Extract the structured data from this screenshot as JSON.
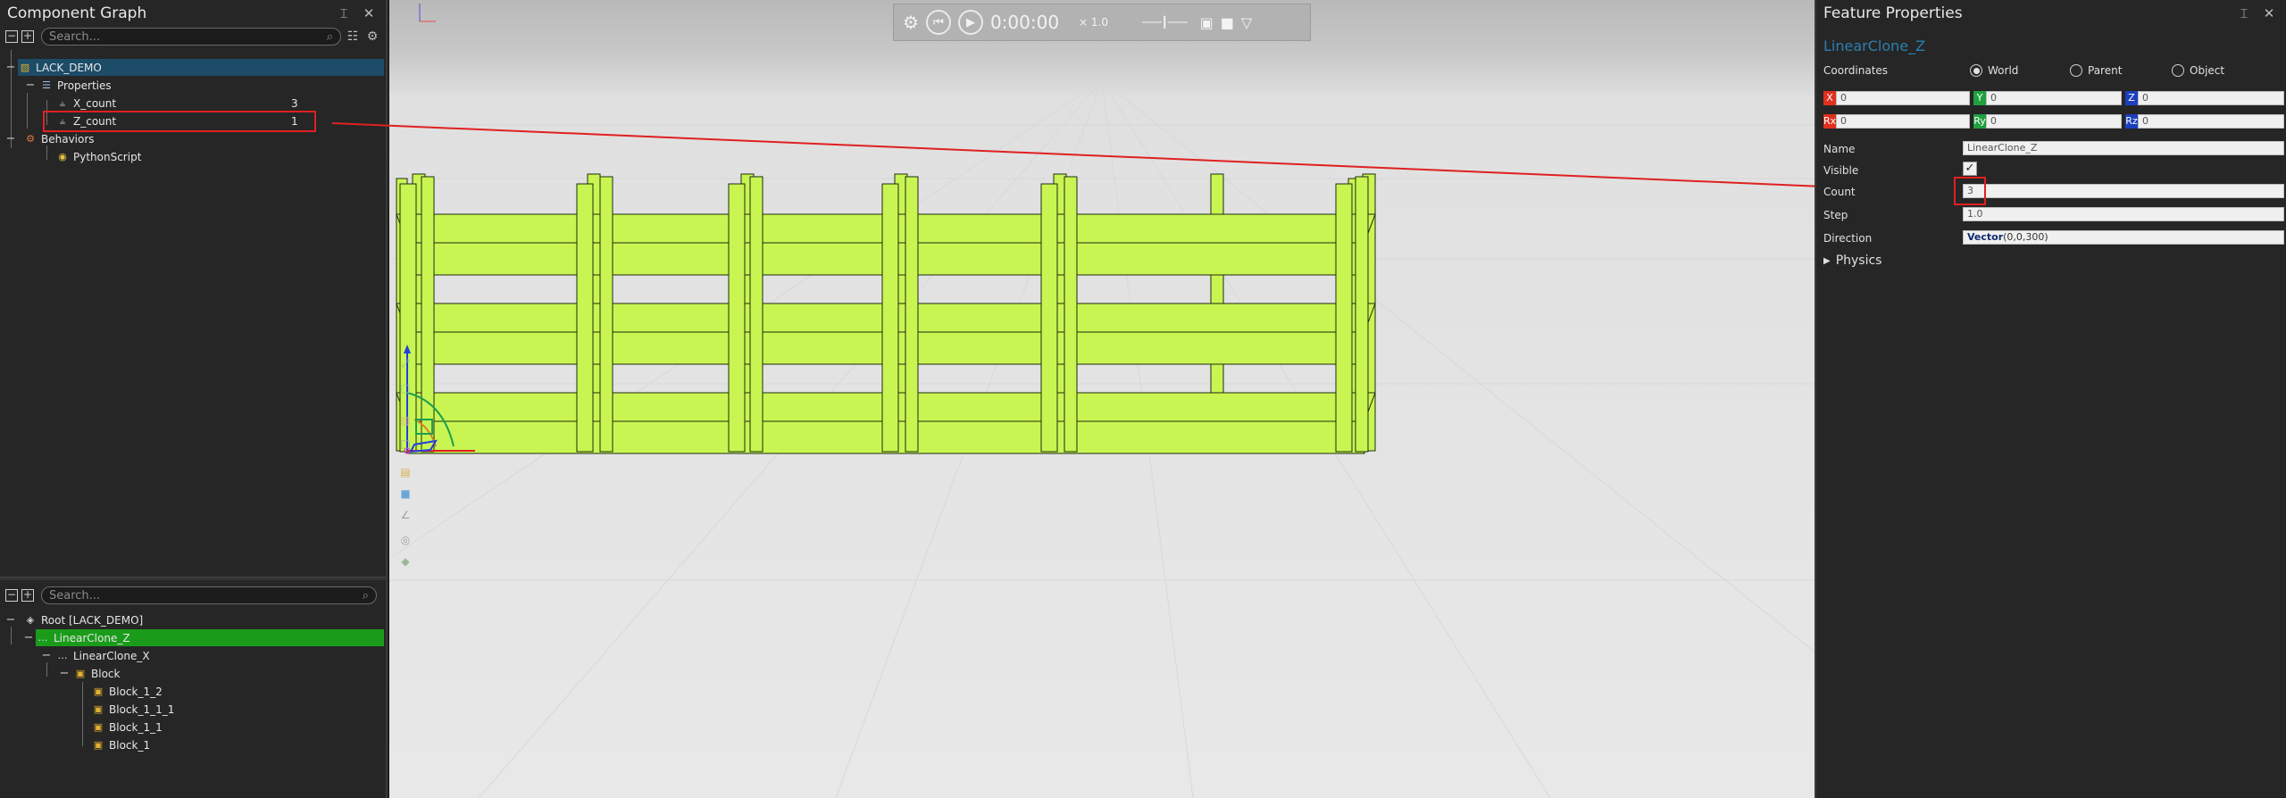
{
  "left_panel": {
    "title": "Component Graph",
    "pin_icon": "pin-icon",
    "close_icon": "close-icon",
    "search_placeholder": "Search...",
    "tree": {
      "root": "LACK_DEMO",
      "properties": "Properties",
      "x_count_label": "X_count",
      "x_count_value": "3",
      "z_count_label": "Z_count",
      "z_count_value": "1",
      "behaviors": "Behaviors",
      "python_script": "PythonScript"
    },
    "search_placeholder_2": "Search...",
    "tree2": {
      "root": "Root [LACK_DEMO]",
      "linear_clone_z": "LinearClone_Z",
      "linear_clone_x": "LinearClone_X",
      "block": "Block",
      "block_1_2": "Block_1_2",
      "block_1_1_1": "Block_1_1_1",
      "block_1_1": "Block_1_1",
      "block_1": "Block_1"
    }
  },
  "viewport": {
    "time": "0:00:00",
    "speed": "× 1.0"
  },
  "right_panel": {
    "title": "Feature Properties",
    "feature_name": "LinearClone_Z",
    "coordinates_label": "Coordinates",
    "radio_world": "World",
    "radio_parent": "Parent",
    "radio_object": "Object",
    "selected_coordinates": "World",
    "x_label": "X",
    "x_value": "0",
    "y_label": "Y",
    "y_value": "0",
    "z_label": "Z",
    "z_value": "0",
    "rx_label": "Rx",
    "rx_value": "0",
    "ry_label": "Ry",
    "ry_value": "0",
    "rz_label": "Rz",
    "rz_value": "0",
    "name_label": "Name",
    "name_value": "LinearClone_Z",
    "visible_label": "Visible",
    "visible_checked": true,
    "count_label": "Count",
    "count_value": "3",
    "step_label": "Step",
    "step_value": "1.0",
    "direction_label": "Direction",
    "direction_keyword": "Vector",
    "direction_value": "(0,0,300)",
    "physics_label": "Physics"
  },
  "colors": {
    "accent_blue": "#2a7fb0",
    "selection_green": "#1a9c1a",
    "shelf_green": "#c9f552",
    "annotation_red": "#e02020"
  }
}
